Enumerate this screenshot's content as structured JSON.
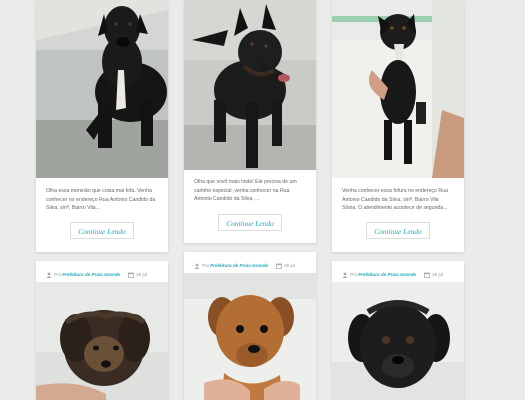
{
  "posts_top": [
    {
      "excerpt": "Olha essa meninão que coisa mai fofa. Venha conhecer no endereço Rua Antonio Candido da Silva, s/nº, Bairro Vila...",
      "more_label": "Continue Lendo",
      "image_icon": "black-dog-photo"
    },
    {
      "excerpt": "Olha que vovô mais lindo! Ele precisa de um carinho especial, venha conhecer na Rua Antonio Candido da Silva, ...",
      "more_label": "Continue Lendo",
      "image_icon": "black-dog-collar-photo"
    },
    {
      "excerpt": "Venha conhecer essa fofura no endereço Rua Antonio Candido da Silva, s/nº, Bairro Vila Sônia. O atendimento acontece de segunda...",
      "more_label": "Continue Lendo",
      "image_icon": "black-puppy-held-photo"
    }
  ],
  "posts_bottom": [
    {
      "by_label": "Por",
      "author": "Prefeitura de Praia Grande",
      "date": "26 jul",
      "image_icon": "scruffy-puppy-photo"
    },
    {
      "by_label": "Por",
      "author": "Prefeitura de Praia Grande",
      "date": "26 jul",
      "image_icon": "brown-puppy-photo"
    },
    {
      "by_label": "Por",
      "author": "Prefeitura de Praia Grande",
      "date": "26 jul",
      "image_icon": "black-puppy-photo"
    }
  ],
  "colors": {
    "accent": "#26a9b8",
    "background": "#ebebeb",
    "card": "#ffffff"
  }
}
